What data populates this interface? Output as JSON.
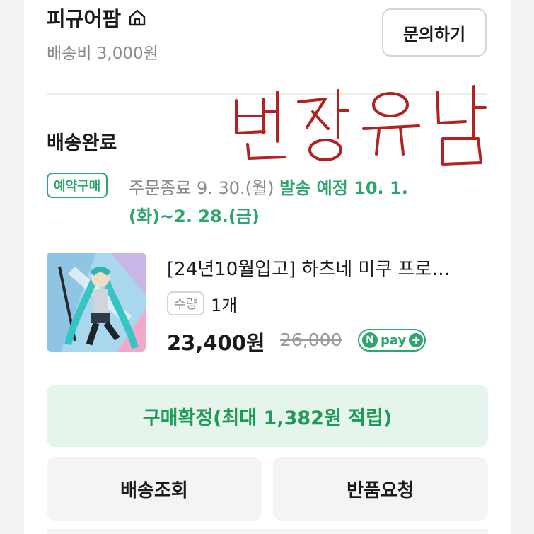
{
  "store": {
    "name": "피규어팜",
    "shipping_fee": "배송비 3,000원",
    "inquiry_label": "문의하기"
  },
  "order": {
    "status": "배송완료",
    "badge": "예약구매",
    "order_end": "주문종료 9. 30.(월) ",
    "ship_plan_line1": "발송 예정 10. 1.",
    "ship_plan_line2": "(화)~2. 28.(금)"
  },
  "handwritten_note": "번장유남",
  "product": {
    "title": "[24년10월입고] 하츠네 미쿠 프로…",
    "qty_label": "수량",
    "qty_value": "1개",
    "price": "23,400원",
    "original_price": "26,000",
    "npay_text": "pay"
  },
  "actions": {
    "confirm": "구매확정(최대 1,382원 적립)",
    "track": "배송조회",
    "return": "반품요청"
  },
  "colors": {
    "accent_green": "#2da66d",
    "confirm_bg": "#e6f5ec",
    "handwriting_red": "#b22222"
  },
  "icons": {
    "home": "home-icon",
    "npay_plus": "plus-icon"
  }
}
